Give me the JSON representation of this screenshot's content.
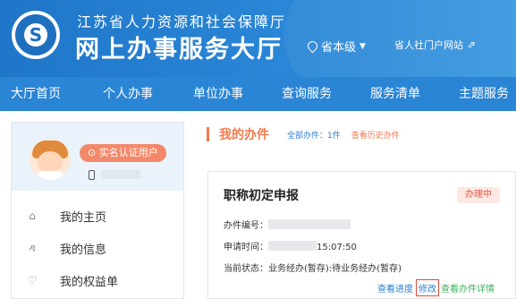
{
  "header": {
    "subtitle": "江苏省人力资源和社会保障厅",
    "title": "网上办事服务大厅",
    "region": "省本级",
    "portal_link": "省人社门户网站"
  },
  "nav": {
    "items": [
      "大厅首页",
      "个人办事",
      "单位办事",
      "查询服务",
      "服务清单",
      "主题服务"
    ]
  },
  "sidebar": {
    "verify_badge": "实名认证用户",
    "menu": [
      {
        "label": "我的主页",
        "icon": "home-icon"
      },
      {
        "label": "我的信息",
        "icon": "user-icon"
      },
      {
        "label": "我的权益单",
        "icon": "shield-icon"
      }
    ]
  },
  "main": {
    "section_title": "我的办件",
    "all_count": "全部办件：1件",
    "history_link": "查看历史办件",
    "case": {
      "title": "职称初定申报",
      "status": "办理中",
      "number_label": "办件编号：",
      "time_label": "申请时间：",
      "time_value": "15:07:50",
      "state_label": "当前状态：",
      "state_value": "业务经办(暂存):待业务经办(暂存)",
      "actions": {
        "progress": "查看进度",
        "edit": "修改",
        "detail": "查看办件详情"
      }
    }
  },
  "colors": {
    "header_blue": "#1f76c9",
    "nav_blue": "#2a85d5",
    "accent_orange": "#f07a4f",
    "link_blue": "#2a7fd4",
    "link_green": "#3bb15b"
  }
}
